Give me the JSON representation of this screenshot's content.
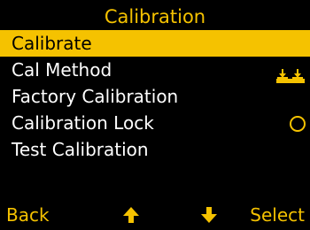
{
  "screen": {
    "title": "Calibration"
  },
  "menu": {
    "items": [
      {
        "label": "Calibrate",
        "selected": true
      },
      {
        "label": "Cal Method",
        "icon": "scale-weights-icon"
      },
      {
        "label": "Factory Calibration"
      },
      {
        "label": "Calibration Lock",
        "icon": "toggle-off-circle-icon"
      },
      {
        "label": "Test Calibration"
      }
    ]
  },
  "softkeys": {
    "back_label": "Back",
    "up_icon": "arrow-up-icon",
    "down_icon": "arrow-down-icon",
    "select_label": "Select"
  },
  "colors": {
    "accent": "#f5c200",
    "background": "#000000",
    "text": "#ffffff"
  }
}
